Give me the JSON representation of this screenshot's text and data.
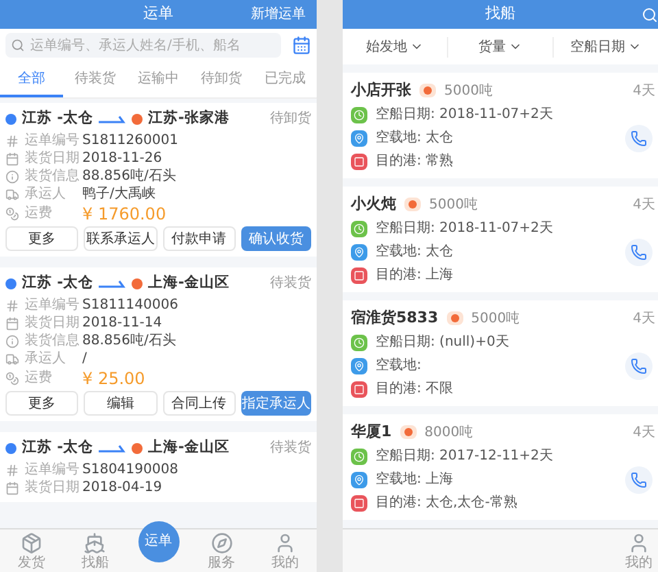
{
  "waybill": {
    "title": "运单",
    "action": "新增运单",
    "search": {
      "placeholder": "运单编号、承运人姓名/手机、船名"
    },
    "tabs": [
      {
        "label": "全部",
        "selected": true
      },
      {
        "label": "待装货",
        "selected": false
      },
      {
        "label": "运输中",
        "selected": false
      },
      {
        "label": "待卸货",
        "selected": false
      },
      {
        "label": "已完成",
        "selected": false
      }
    ],
    "orders": [
      {
        "from": "江苏 -太仓",
        "to": "江苏-张家港",
        "status": "待卸货",
        "fields": [
          {
            "label": "运单编号",
            "value": "S1811260001"
          },
          {
            "label": "装货日期",
            "value": "2018-11-26"
          },
          {
            "label": "装货信息",
            "value": "88.856吨/石头"
          },
          {
            "label": "承运人",
            "value": "鸭子/大禹峡"
          }
        ],
        "fee_label": "运费",
        "fee": "¥ 1760.00",
        "buttons": [
          {
            "label": "更多",
            "primary": false
          },
          {
            "label": "联系承运人",
            "primary": false
          },
          {
            "label": "付款申请",
            "primary": false
          },
          {
            "label": "确认收货",
            "primary": true
          }
        ]
      },
      {
        "from": "江苏 -太仓",
        "to": "上海-金山区",
        "status": "待装货",
        "fields": [
          {
            "label": "运单编号",
            "value": "S1811140006"
          },
          {
            "label": "装货日期",
            "value": "2018-11-14"
          },
          {
            "label": "装货信息",
            "value": "88.856吨/石头"
          },
          {
            "label": "承运人",
            "value": "/"
          }
        ],
        "fee_label": "运费",
        "fee": "¥ 25.00",
        "buttons": [
          {
            "label": "更多",
            "primary": false
          },
          {
            "label": "编辑",
            "primary": false
          },
          {
            "label": "合同上传",
            "primary": false
          },
          {
            "label": "指定承运人",
            "primary": true
          }
        ]
      },
      {
        "from": "江苏 -太仓",
        "to": "上海-金山区",
        "status": "待装货",
        "fields": [
          {
            "label": "运单编号",
            "value": "S1804190008"
          },
          {
            "label": "装货日期",
            "value": "2018-04-19"
          }
        ]
      }
    ],
    "nav": [
      {
        "label": "发货",
        "kind": "box",
        "selected": false
      },
      {
        "label": "找船",
        "kind": "ship",
        "selected": false
      },
      {
        "label": "运单",
        "kind": "center",
        "selected": true
      },
      {
        "label": "服务",
        "kind": "compass",
        "selected": false
      },
      {
        "label": "我的",
        "kind": "user",
        "selected": false
      }
    ]
  },
  "find_ship": {
    "title": "找船",
    "filters": [
      "始发地",
      "货量",
      "空船日期"
    ],
    "ships": [
      {
        "name": "小店开张",
        "tonnage": "5000吨",
        "age": "4天",
        "rows": [
          {
            "kind": "date",
            "text": "空船日期: 2018-11-07+2天"
          },
          {
            "kind": "place",
            "text": "空载地: 太仓"
          },
          {
            "kind": "port",
            "text": "目的港: 常熟"
          }
        ]
      },
      {
        "name": "小火炖",
        "tonnage": "5000吨",
        "age": "4天",
        "rows": [
          {
            "kind": "date",
            "text": "空船日期: 2018-11-07+2天"
          },
          {
            "kind": "place",
            "text": "空载地: 太仓"
          },
          {
            "kind": "port",
            "text": "目的港: 上海"
          }
        ]
      },
      {
        "name": "宿淮货5833",
        "tonnage": "5000吨",
        "age": "4天",
        "rows": [
          {
            "kind": "date",
            "text": "空船日期: (null)+0天"
          },
          {
            "kind": "place",
            "text": "空载地:"
          },
          {
            "kind": "port",
            "text": "目的港: 不限"
          }
        ]
      },
      {
        "name": "华厦1",
        "tonnage": "8000吨",
        "age": "4天",
        "rows": [
          {
            "kind": "date",
            "text": "空船日期: 2017-12-11+2天"
          },
          {
            "kind": "place",
            "text": "空载地: 上海"
          },
          {
            "kind": "port",
            "text": "目的港: 太仓,太仓-常熟"
          }
        ]
      }
    ],
    "nav": [
      {
        "label": "我的",
        "kind": "user"
      }
    ]
  }
}
